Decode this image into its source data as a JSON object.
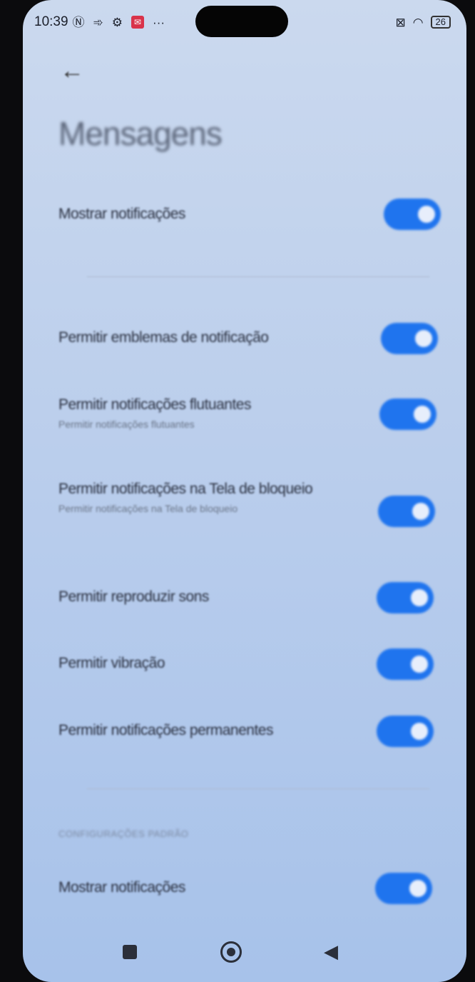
{
  "status_bar": {
    "time": "10:39",
    "icons": [
      "nfc-icon",
      "sync-icon",
      "gear-icon",
      "app-notification-icon",
      "more-icon"
    ],
    "right_icons": [
      "sim-off-icon",
      "wifi-icon"
    ],
    "battery": "26"
  },
  "header": {
    "back_icon": "arrow-left-icon",
    "title": "Mensagens"
  },
  "main_toggle": {
    "label": "Mostrar notificações",
    "on": true
  },
  "settings": [
    {
      "label": "Permitir emblemas de notificação",
      "sub": "",
      "on": true
    },
    {
      "label": "Permitir notificações flutuantes",
      "sub": "Permitir notificações flutuantes",
      "on": true
    },
    {
      "label": "Permitir notificações na Tela de bloqueio",
      "sub": "Permitir notificações na Tela de bloqueio",
      "on": true
    },
    {
      "label": "Permitir reproduzir sons",
      "sub": "",
      "on": true
    },
    {
      "label": "Permitir vibração",
      "sub": "",
      "on": true
    },
    {
      "label": "Permitir notificações permanentes",
      "sub": "",
      "on": true
    }
  ],
  "section": {
    "header": "CONFIGURAÇÕES PADRÃO",
    "label": "Mostrar notificações",
    "on": true
  },
  "nav": {
    "recents": "square-icon",
    "home": "circle-icon",
    "back": "triangle-back-icon"
  },
  "colors": {
    "toggle_on": "#1f74ee",
    "background": "#b9cdec"
  }
}
